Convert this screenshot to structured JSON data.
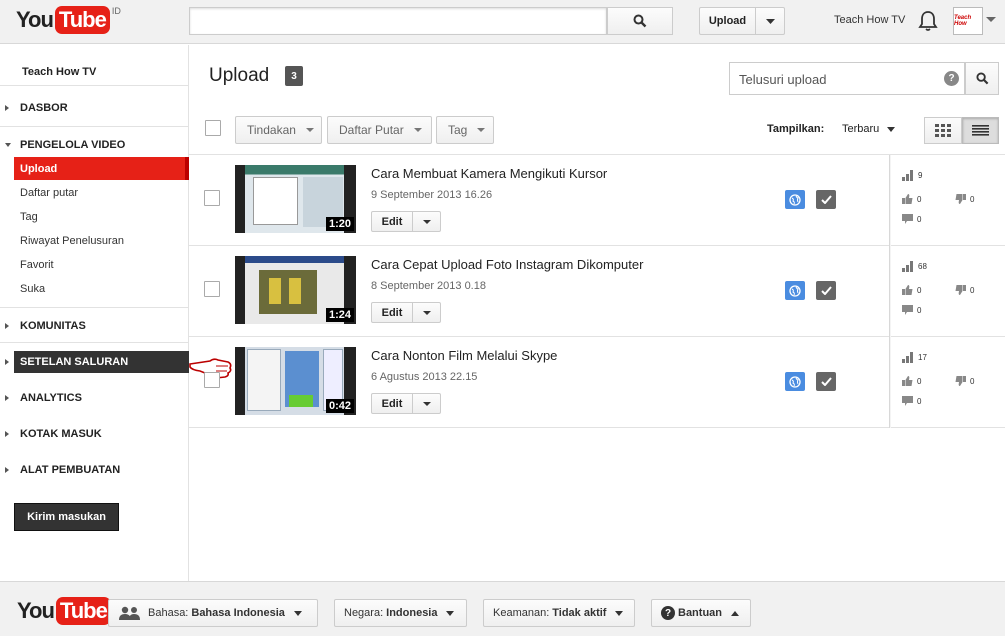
{
  "header": {
    "logo_you": "You",
    "logo_tube": "Tube",
    "logo_region": "ID",
    "search_placeholder": "",
    "upload_label": "Upload",
    "channel_name": "Teach How TV",
    "avatar_text": "Teach How"
  },
  "sidebar": {
    "channel": "Teach How TV",
    "sections": {
      "dashboard": "DASBOR",
      "video_manager": "PENGELOLA VIDEO",
      "community": "KOMUNITAS",
      "channel_settings": "SETELAN SALURAN",
      "analytics": "ANALYTICS",
      "inbox": "KOTAK MASUK",
      "creation_tools": "ALAT PEMBUATAN"
    },
    "sub": {
      "upload": "Upload",
      "playlists": "Daftar putar",
      "tags": "Tag",
      "search_history": "Riwayat Penelusuran",
      "favorites": "Favorit",
      "likes": "Suka"
    },
    "feedback": "Kirim masukan"
  },
  "main": {
    "title": "Upload",
    "count": "3",
    "search_placeholder": "Telusuri upload",
    "actions_label": "Tindakan",
    "playlist_label": "Daftar Putar",
    "tag_label": "Tag",
    "show_label": "Tampilkan:",
    "sort_value": "Terbaru"
  },
  "videos": [
    {
      "title": "Cara Membuat Kamera Mengikuti Kursor",
      "date": "9 September 2013 16.26",
      "duration": "1:20",
      "edit": "Edit",
      "views": "9",
      "likes": "0",
      "dislikes": "0",
      "comments": "0"
    },
    {
      "title": "Cara Cepat Upload Foto Instagram Dikomputer",
      "date": "8 September 2013 0.18",
      "duration": "1:24",
      "edit": "Edit",
      "views": "68",
      "likes": "0",
      "dislikes": "0",
      "comments": "0"
    },
    {
      "title": "Cara Nonton Film Melalui Skype",
      "date": "6 Agustus 2013 22.15",
      "duration": "0:42",
      "edit": "Edit",
      "views": "17",
      "likes": "0",
      "dislikes": "0",
      "comments": "0"
    }
  ],
  "footer": {
    "language_label": "Bahasa:",
    "language_value": "Bahasa Indonesia",
    "country_label": "Negara:",
    "country_value": "Indonesia",
    "safety_label": "Keamanan:",
    "safety_value": "Tidak aktif",
    "help_label": "Bantuan"
  },
  "colors": {
    "brand_red": "#e62117",
    "privacy_blue": "#4a8ce0"
  }
}
